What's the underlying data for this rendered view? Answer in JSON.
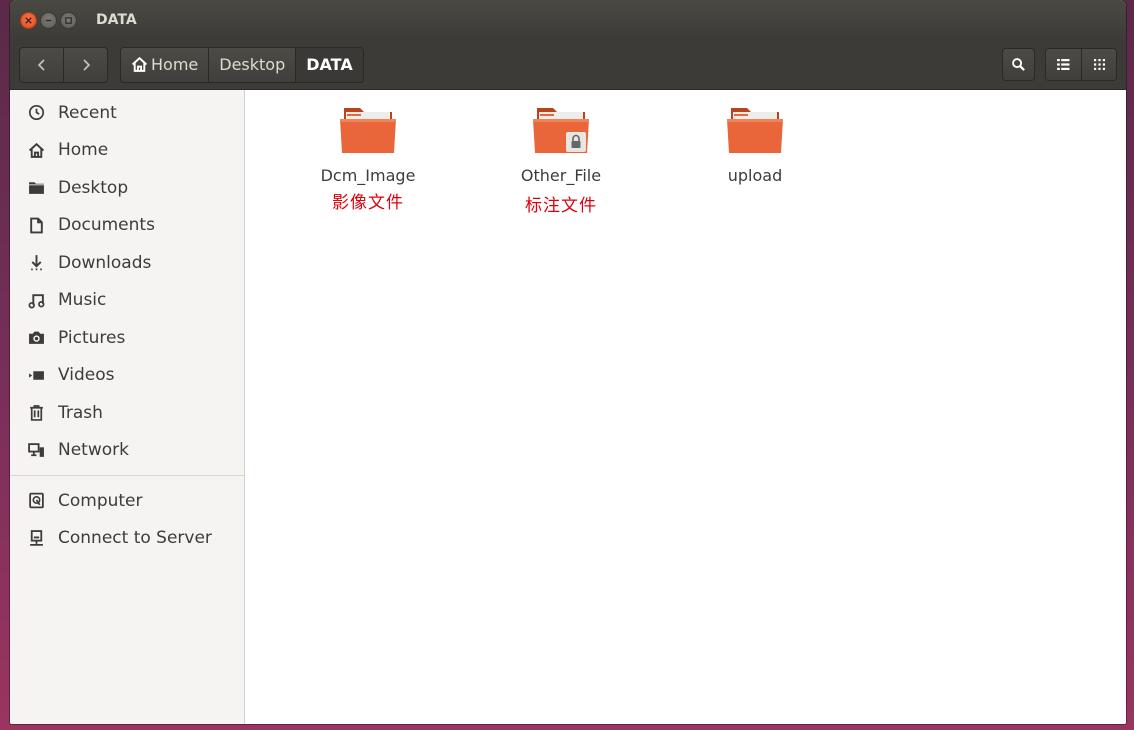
{
  "window": {
    "title": "DATA"
  },
  "toolbar": {
    "back_icon": "chevron-left-icon",
    "forward_icon": "chevron-right-icon",
    "breadcrumbs": [
      "Home",
      "Desktop",
      "DATA"
    ],
    "search_icon": "search-icon",
    "list_view_icon": "list-view-icon",
    "grid_view_icon": "grid-view-icon"
  },
  "sidebar": {
    "items": [
      {
        "label": "Recent",
        "icon": "clock-icon"
      },
      {
        "label": "Home",
        "icon": "home-icon"
      },
      {
        "label": "Desktop",
        "icon": "folder-icon"
      },
      {
        "label": "Documents",
        "icon": "document-icon"
      },
      {
        "label": "Downloads",
        "icon": "download-icon"
      },
      {
        "label": "Music",
        "icon": "music-icon"
      },
      {
        "label": "Pictures",
        "icon": "camera-icon"
      },
      {
        "label": "Videos",
        "icon": "video-icon"
      },
      {
        "label": "Trash",
        "icon": "trash-icon"
      },
      {
        "label": "Network",
        "icon": "network-icon"
      }
    ],
    "devices": [
      {
        "label": "Computer",
        "icon": "computer-icon"
      },
      {
        "label": "Connect to Server",
        "icon": "server-icon"
      }
    ]
  },
  "files": [
    {
      "name": "Dcm_Image",
      "annotation": "影像文件",
      "locked": false
    },
    {
      "name": "Other_File",
      "annotation": "标注文件",
      "locked": true
    },
    {
      "name": "upload",
      "annotation": "",
      "locked": false
    }
  ],
  "colors": {
    "folder_orange": "#e9663a",
    "annotation_red": "#e0000a",
    "titlebar": "#3c3b37",
    "close_button": "#e2572b"
  }
}
